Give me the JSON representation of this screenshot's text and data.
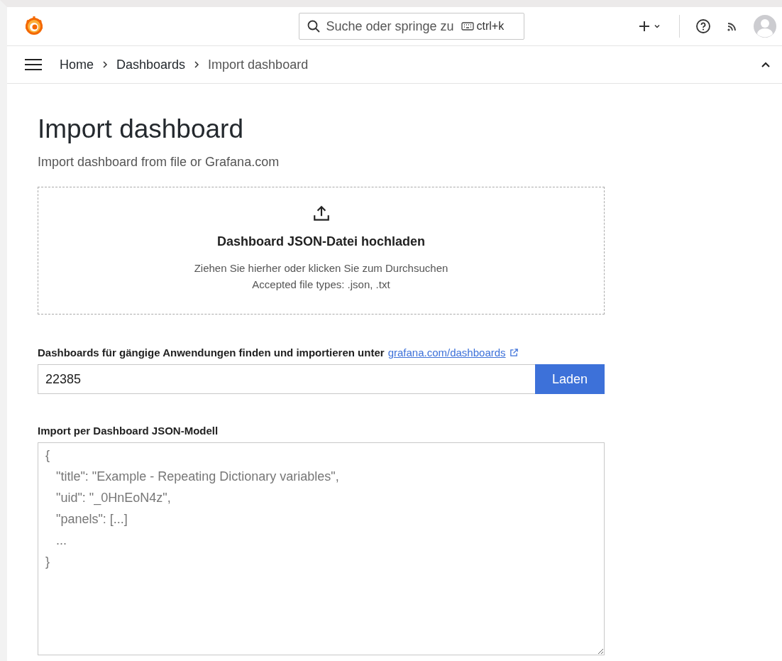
{
  "top_bar": {
    "search": {
      "placeholder": "Suche oder springe zu",
      "shortcut": "ctrl+k"
    }
  },
  "breadcrumb": [
    {
      "label": "Home",
      "selected": false
    },
    {
      "label": "Dashboards",
      "selected": false
    },
    {
      "label": "Import dashboard",
      "selected": true
    }
  ],
  "page": {
    "title": "Import dashboard",
    "subtitle": "Import dashboard from file or Grafana.com"
  },
  "upload": {
    "title": "Dashboard JSON-Datei hochladen",
    "hint": "Ziehen Sie hierher oder klicken Sie zum Durchsuchen",
    "accepted": "Accepted file types: .json, .txt"
  },
  "grafana_import": {
    "label": "Dashboards für gängige Anwendungen finden und importieren unter",
    "link": "grafana.com/dashboards",
    "value": "22385",
    "button": "Laden"
  },
  "json_import": {
    "label": "Import per Dashboard JSON-Modell",
    "placeholder_lines": [
      "{",
      "   \"title\": \"Example - Repeating Dictionary variables\",",
      "   \"uid\": \"_0HnEoN4z\",",
      "   \"panels\": [...]",
      "   ...",
      "}"
    ]
  }
}
